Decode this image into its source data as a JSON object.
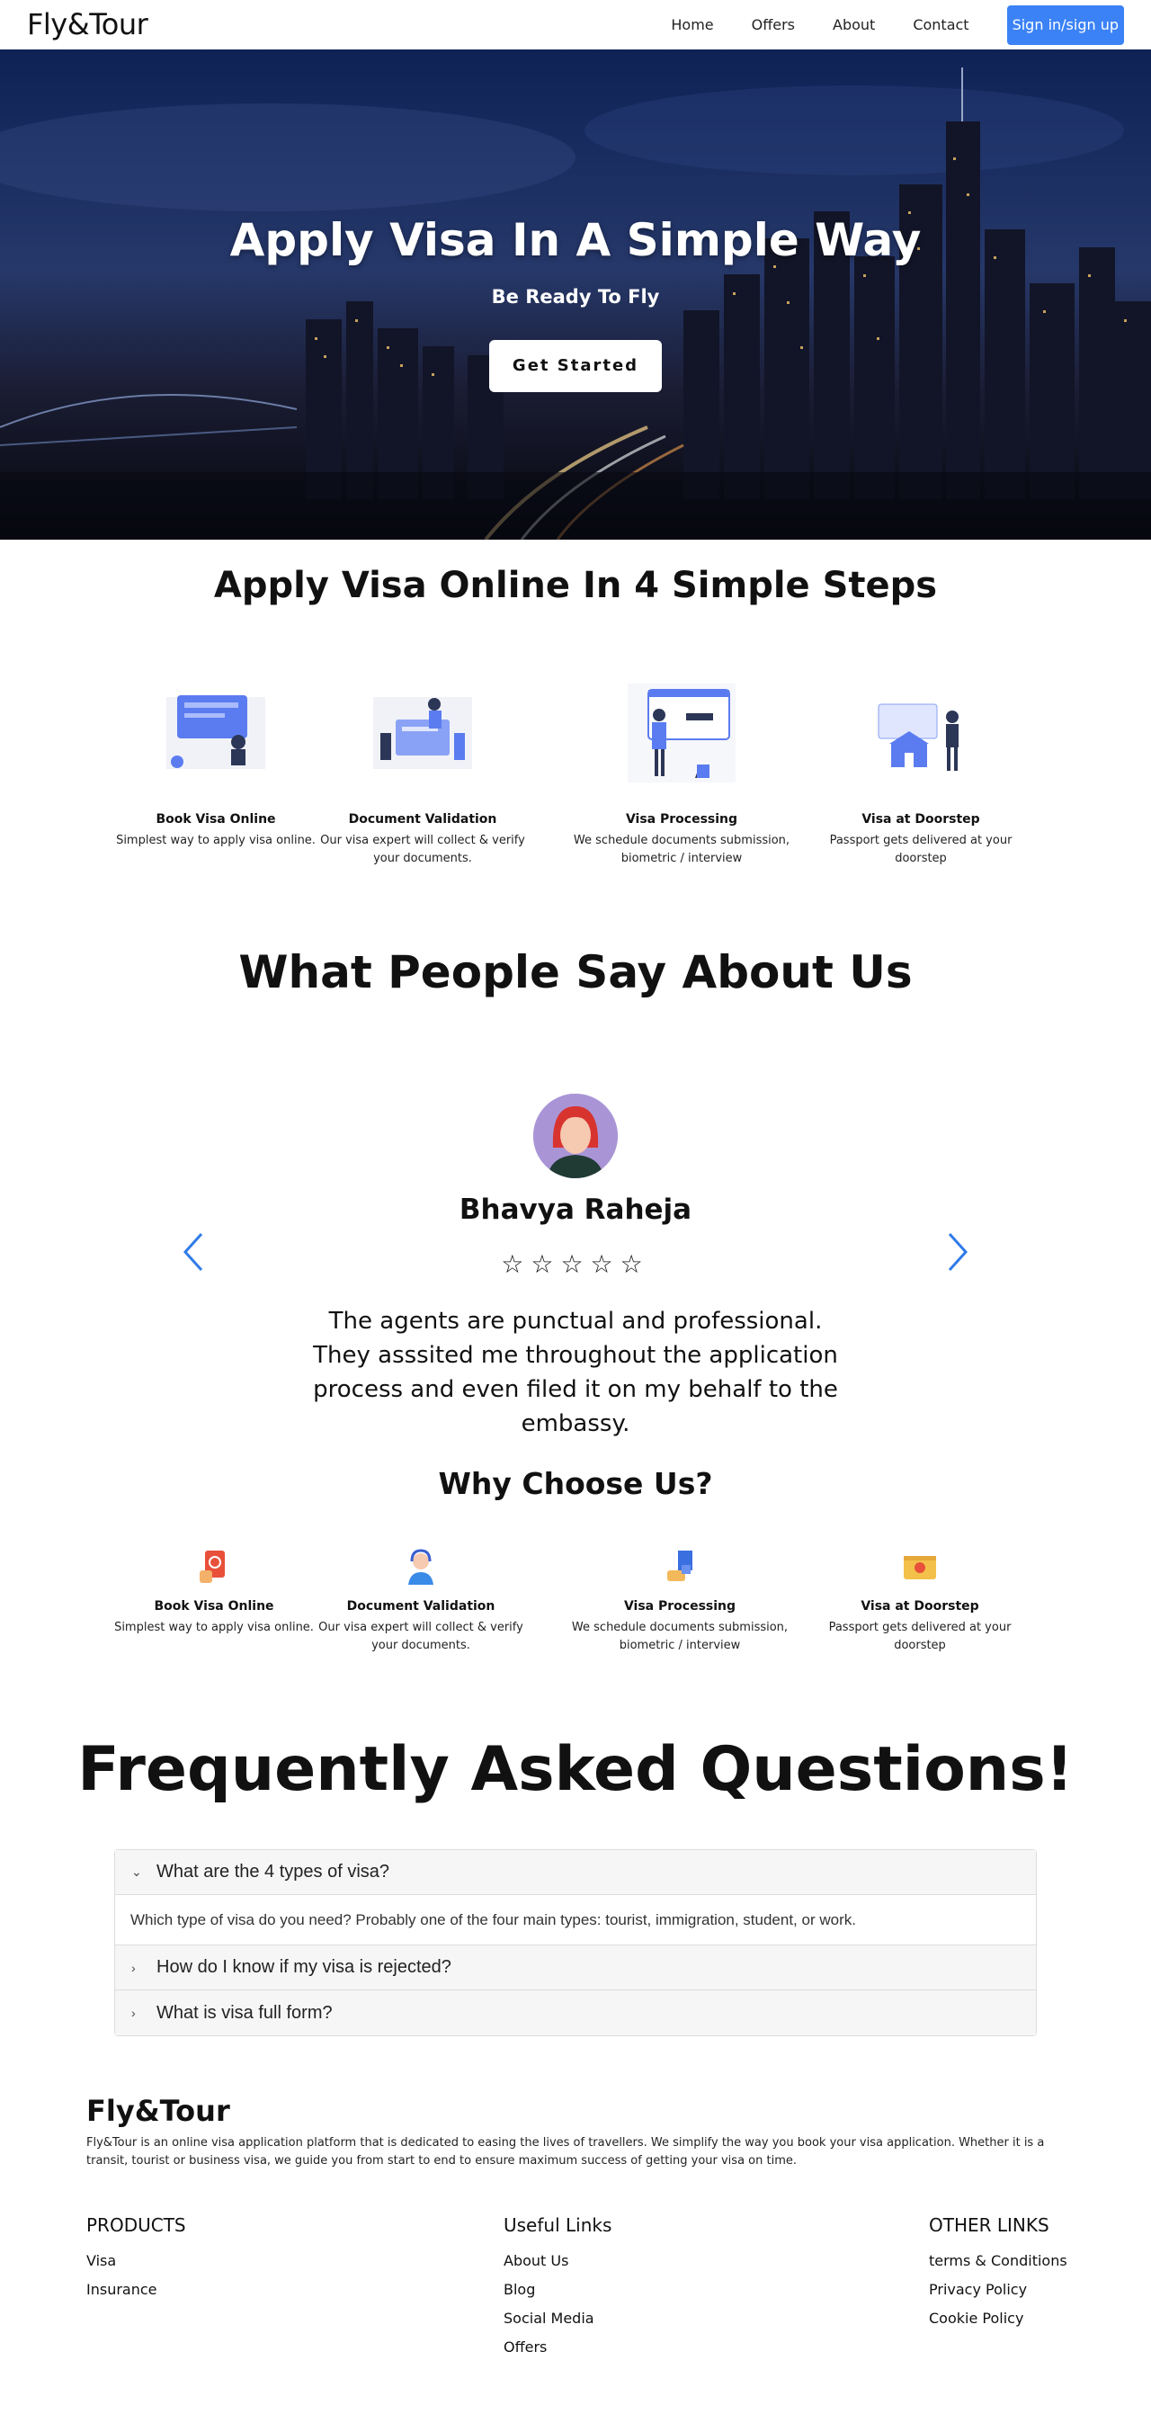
{
  "nav": {
    "brand": "Fly&Tour",
    "links": [
      "Home",
      "Offers",
      "About",
      "Contact"
    ],
    "signin": "Sign in/sign up"
  },
  "hero": {
    "title": "Apply Visa In A Simple Way",
    "subtitle": "Be Ready To Fly",
    "cta": "Get Started"
  },
  "steps": {
    "title": "Apply Visa Online In 4 Simple Steps",
    "items": [
      {
        "title": "Book Visa Online",
        "desc": "Simplest way to apply visa online."
      },
      {
        "title": "Document Validation",
        "desc": "Our visa expert will collect & verify your documents."
      },
      {
        "title": "Visa Processing",
        "desc": "We schedule documents submission, biometric / interview"
      },
      {
        "title": "Visa at Doorstep",
        "desc": "Passport gets delivered at your doorstep"
      }
    ]
  },
  "testimonials": {
    "title": "What People Say About Us",
    "name": "Bhavya Raheja",
    "stars": "☆☆☆☆☆",
    "text": "The agents are punctual and professional. They asssited me throughout the application process and even filed it on my behalf to the embassy."
  },
  "why": {
    "title": "Why Choose Us?",
    "items": [
      {
        "title": "Book Visa Online",
        "desc": "Simplest way to apply visa online."
      },
      {
        "title": "Document Validation",
        "desc": "Our visa expert will collect & verify your documents."
      },
      {
        "title": "Visa Processing",
        "desc": "We schedule documents submission, biometric / interview"
      },
      {
        "title": "Visa at Doorstep",
        "desc": "Passport gets delivered at your doorstep"
      }
    ]
  },
  "faq": {
    "title": "Frequently Asked Questions!",
    "items": [
      {
        "q": "What are the 4 types of visa?",
        "a": "Which type of visa do you need? Probably one of the four main types: tourist, immigration, student, or work."
      },
      {
        "q": "How do I know if my visa is rejected?"
      },
      {
        "q": "What is visa full form?"
      }
    ]
  },
  "footer": {
    "brand": "Fly&Tour",
    "desc": "Fly&Tour is an online visa application platform that is dedicated to easing the lives of travellers. We simplify the way you book your visa application. Whether it is a transit, tourist or business visa, we guide you from start to end to ensure maximum success of getting your visa on time.",
    "columns": [
      {
        "title": "PRODUCTS",
        "links": [
          "Visa",
          "Insurance"
        ]
      },
      {
        "title": "Useful Links",
        "links": [
          "About Us",
          "Blog",
          "Social Media",
          "Offers"
        ]
      },
      {
        "title": "OTHER LINKS",
        "links": [
          "terms & Conditions",
          "Privacy Policy",
          "Cookie Policy"
        ]
      }
    ]
  },
  "colors": {
    "accent": "#3b82f6",
    "illustration": "#5b7cf0"
  }
}
